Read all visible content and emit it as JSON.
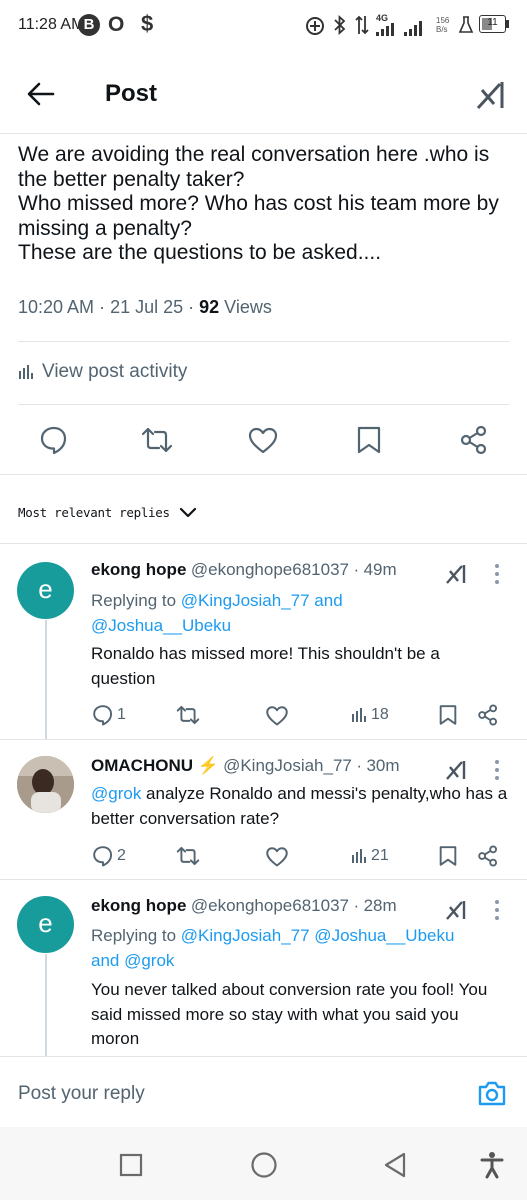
{
  "status_bar": {
    "time": "11:28 AM",
    "notif_b": "B",
    "notif_o": "O",
    "notif_s": "$",
    "net_type": "4G",
    "net_speed_top": "156",
    "net_speed_bottom": "B/s",
    "battery": "11"
  },
  "header": {
    "title": "Post"
  },
  "post": {
    "text": "We are avoiding the real conversation here .who is the better penalty taker?\nWho missed more? Who has cost his team more by missing a penalty?\nThese are the questions to be asked....",
    "time": "10:20 AM",
    "date": "21 Jul 25",
    "views_count": "92",
    "views_label": "Views",
    "activity_label": "View post activity"
  },
  "replies_sort_label": "Most relevant replies",
  "replies": [
    {
      "avatar_letter": "e",
      "name": "ekong hope",
      "handle": "@ekonghope681037",
      "time": "49m",
      "replying_prefix": "Replying to",
      "replying_line1": "@KingJosiah_77 and",
      "replying_line2": "@Joshua__Ubeku",
      "body": "Ronaldo has missed more! This shouldn't be a question",
      "reply_count": "1",
      "views": "18"
    },
    {
      "name": "OMACHONU",
      "badge": "⚡",
      "handle": "@KingJosiah_77",
      "time": "30m",
      "mention": "@grok",
      "body": " analyze Ronaldo and messi's penalty,who has a better conversation rate?",
      "reply_count": "2",
      "views": "21"
    },
    {
      "avatar_letter": "e",
      "name": "ekong hope",
      "handle": "@ekonghope681037",
      "time": "28m",
      "replying_prefix": "Replying to",
      "replying_line1": "@KingJosiah_77 @Joshua__Ubeku",
      "replying_line2": "and @grok",
      "body": "You never talked about conversion rate you fool! You said missed more so stay with what you said you moron"
    }
  ],
  "reply_input": {
    "placeholder": "Post your reply"
  },
  "colors": {
    "accent": "#1d9bf0",
    "avatar_teal": "#189b9b",
    "text": "#0f1419",
    "muted": "#536471"
  }
}
